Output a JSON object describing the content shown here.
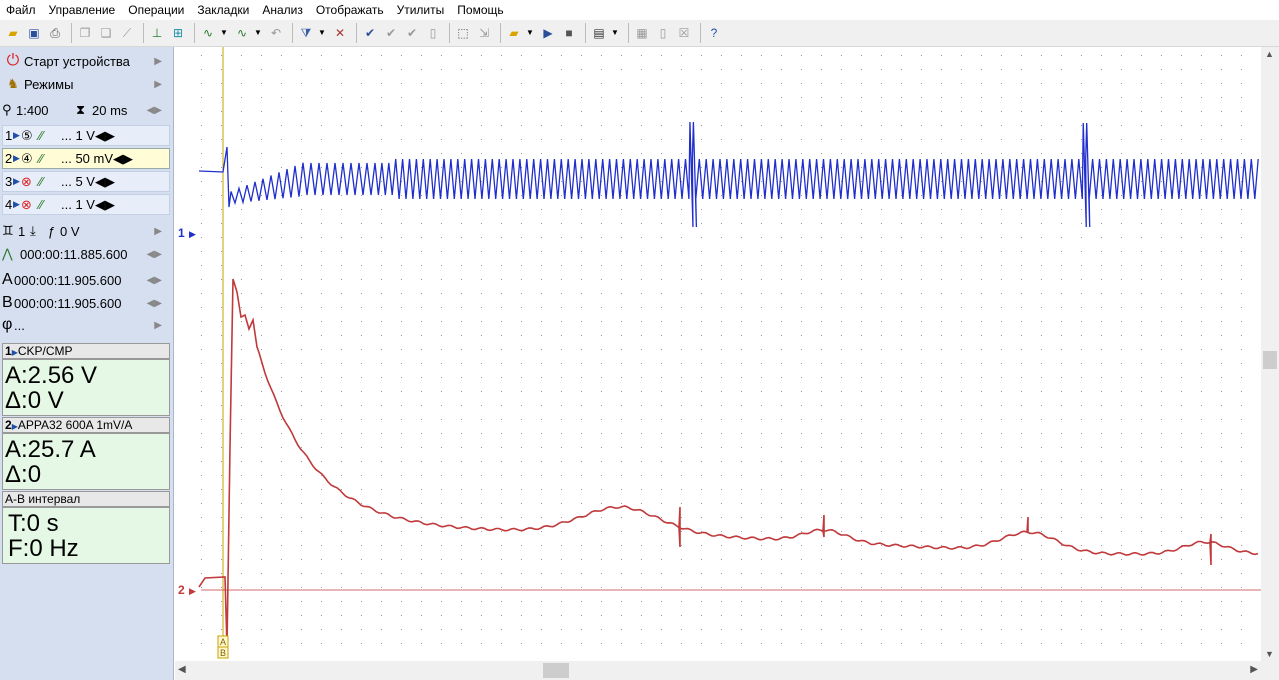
{
  "menu": [
    "Файл",
    "Управление",
    "Операции",
    "Закладки",
    "Анализ",
    "Отображать",
    "Утилиты",
    "Помощь"
  ],
  "left": {
    "start_label": "Старт устройства",
    "modes_label": "Режимы",
    "zoom": "1:400",
    "timebase": "20 ms",
    "channels": [
      {
        "num": "1",
        "scale": "... 1 V"
      },
      {
        "num": "2",
        "scale": "... 50 mV"
      },
      {
        "num": "3",
        "scale": "... 5 V"
      },
      {
        "num": "4",
        "scale": "... 1 V"
      }
    ],
    "trigger_channel": "1",
    "trigger_level": "0 V",
    "trigger_time": "000:00:11.885.600",
    "cursor_a": "000:00:11.905.600",
    "cursor_b": "000:00:11.905.600",
    "phi": "...",
    "panel1_head": "CKP/CMP",
    "panel1_a": "A:2.56 V",
    "panel1_d": "Δ:0 V",
    "panel2_head": "APPA32 600A 1mV/A",
    "panel2_a": "A:25.7 A",
    "panel2_d": "Δ:0",
    "panel3_head": "A-B интервал",
    "panel3_t": "T:0 s",
    "panel3_f": "F:0 Hz"
  },
  "plot": {
    "ch1_marker": "1",
    "ch2_marker": "2",
    "cursor_a": "A",
    "cursor_b": "B",
    "ch1_color": "#1f2ecc",
    "ch2_color": "#c0393b"
  }
}
